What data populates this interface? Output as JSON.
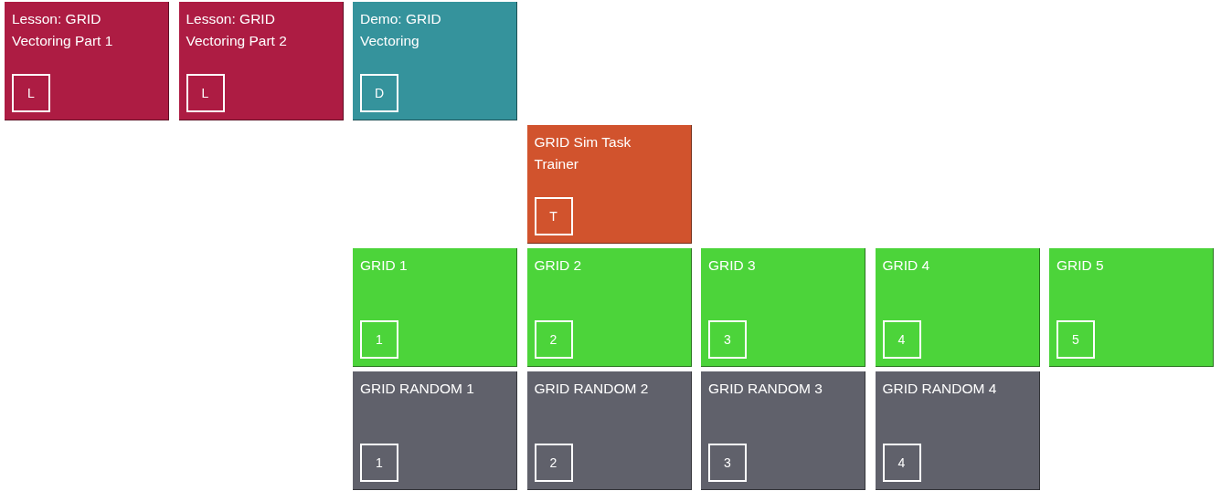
{
  "rows": [
    {
      "tiles": [
        {
          "kind": "lesson",
          "title": "Lesson: GRID Vectoring Part 1",
          "badge": "L"
        },
        {
          "kind": "lesson",
          "title": "Lesson: GRID Vectoring Part 2",
          "badge": "L"
        },
        {
          "kind": "demo",
          "title": "Demo: GRID Vectoring",
          "badge": "D"
        }
      ]
    },
    {
      "tiles": [
        {
          "kind": "trainer",
          "title": "GRID Sim Task Trainer",
          "badge": "T"
        }
      ]
    },
    {
      "tiles": [
        {
          "kind": "grid",
          "title": "GRID 1",
          "badge": "1"
        },
        {
          "kind": "grid",
          "title": "GRID 2",
          "badge": "2"
        },
        {
          "kind": "grid",
          "title": "GRID 3",
          "badge": "3"
        },
        {
          "kind": "grid",
          "title": "GRID 4",
          "badge": "4"
        },
        {
          "kind": "grid",
          "title": "GRID 5",
          "badge": "5"
        }
      ]
    },
    {
      "tiles": [
        {
          "kind": "random",
          "title": "GRID RANDOM 1",
          "badge": "1"
        },
        {
          "kind": "random",
          "title": "GRID RANDOM 2",
          "badge": "2"
        },
        {
          "kind": "random",
          "title": "GRID RANDOM 3",
          "badge": "3"
        },
        {
          "kind": "random",
          "title": "GRID RANDOM 4",
          "badge": "4"
        }
      ]
    }
  ]
}
